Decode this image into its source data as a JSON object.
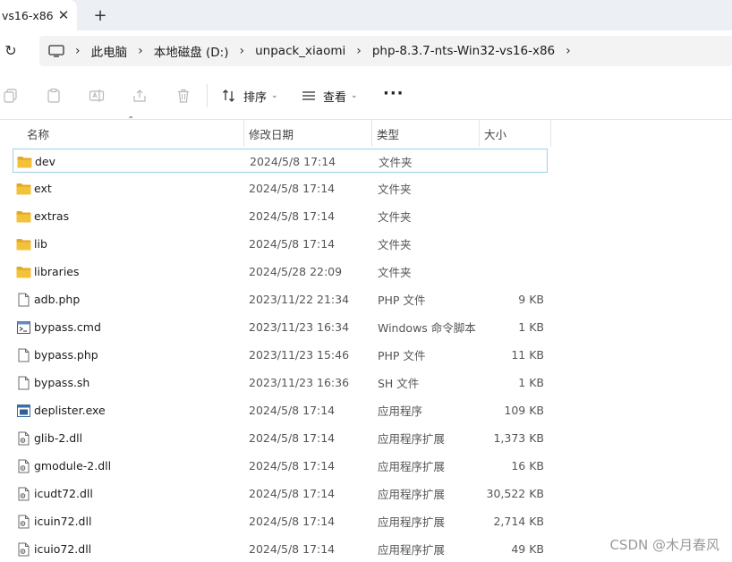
{
  "window": {
    "tab_title": "vs16-x86",
    "tab_close": "✕",
    "new_tab": "+"
  },
  "address": {
    "refresh": "↻",
    "breadcrumbs": [
      "此电脑",
      "本地磁盘 (D:)",
      "unpack_xiaomi",
      "php-8.3.7-nts-Win32-vs16-x86"
    ],
    "separator": "›"
  },
  "toolbar": {
    "sort_label": "排序",
    "view_label": "查看",
    "more_label": "···",
    "chevron": "⌄"
  },
  "columns": {
    "name": "名称",
    "date": "修改日期",
    "type": "类型",
    "size": "大小",
    "sort_indicator": "⌃"
  },
  "files": [
    {
      "name": "dev",
      "date": "2024/5/8 17:14",
      "type": "文件夹",
      "size": "",
      "icon": "folder-icon",
      "selected": true
    },
    {
      "name": "ext",
      "date": "2024/5/8 17:14",
      "type": "文件夹",
      "size": "",
      "icon": "folder-icon"
    },
    {
      "name": "extras",
      "date": "2024/5/8 17:14",
      "type": "文件夹",
      "size": "",
      "icon": "folder-icon"
    },
    {
      "name": "lib",
      "date": "2024/5/8 17:14",
      "type": "文件夹",
      "size": "",
      "icon": "folder-icon"
    },
    {
      "name": "libraries",
      "date": "2024/5/28 22:09",
      "type": "文件夹",
      "size": "",
      "icon": "folder-icon"
    },
    {
      "name": "adb.php",
      "date": "2023/11/22 21:34",
      "type": "PHP 文件",
      "size": "9 KB",
      "icon": "file-icon"
    },
    {
      "name": "bypass.cmd",
      "date": "2023/11/23 16:34",
      "type": "Windows 命令脚本",
      "size": "1 KB",
      "icon": "script-icon"
    },
    {
      "name": "bypass.php",
      "date": "2023/11/23 15:46",
      "type": "PHP 文件",
      "size": "11 KB",
      "icon": "file-icon"
    },
    {
      "name": "bypass.sh",
      "date": "2023/11/23 16:36",
      "type": "SH 文件",
      "size": "1 KB",
      "icon": "file-icon"
    },
    {
      "name": "deplister.exe",
      "date": "2024/5/8 17:14",
      "type": "应用程序",
      "size": "109 KB",
      "icon": "exe-icon"
    },
    {
      "name": "glib-2.dll",
      "date": "2024/5/8 17:14",
      "type": "应用程序扩展",
      "size": "1,373 KB",
      "icon": "dll-icon"
    },
    {
      "name": "gmodule-2.dll",
      "date": "2024/5/8 17:14",
      "type": "应用程序扩展",
      "size": "16 KB",
      "icon": "dll-icon"
    },
    {
      "name": "icudt72.dll",
      "date": "2024/5/8 17:14",
      "type": "应用程序扩展",
      "size": "30,522 KB",
      "icon": "dll-icon"
    },
    {
      "name": "icuin72.dll",
      "date": "2024/5/8 17:14",
      "type": "应用程序扩展",
      "size": "2,714 KB",
      "icon": "dll-icon"
    },
    {
      "name": "icuio72.dll",
      "date": "2024/5/8 17:14",
      "type": "应用程序扩展",
      "size": "49 KB",
      "icon": "dll-icon"
    }
  ],
  "watermark": "CSDN @木月春风",
  "colors": {
    "folder": "#f3c13a",
    "folder_dark": "#e3a81f",
    "selection_border": "#9ecfe8"
  }
}
